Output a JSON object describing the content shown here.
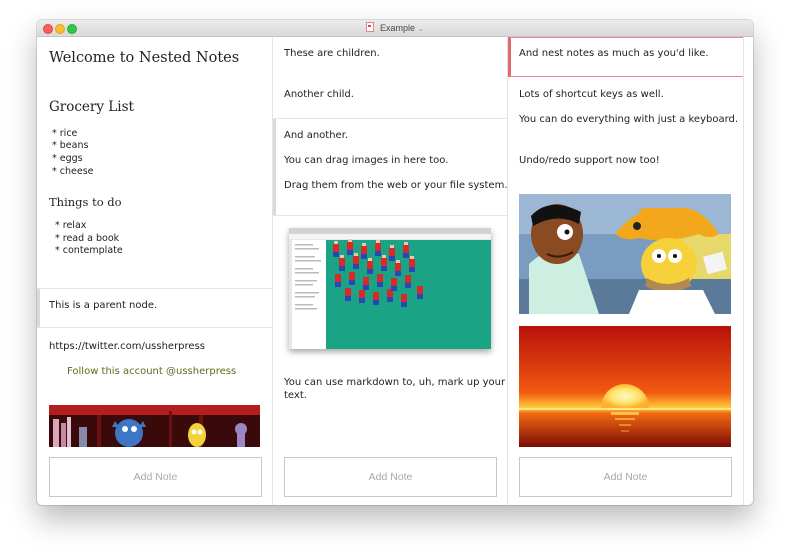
{
  "window": {
    "title": "Example"
  },
  "columns": [
    {
      "notes": {
        "welcome": "Welcome to Nested Notes",
        "grocery_title": "Grocery List",
        "grocery_items": [
          "* rice",
          "* beans",
          "* eggs",
          "* cheese"
        ],
        "todo_title": "Things to do",
        "todo_items": [
          "* relax",
          "* read a book",
          "* contemplate"
        ],
        "parent": "This is a parent node.",
        "url": "https://twitter.com/ussherpress",
        "follow": "Follow this account @ussherpress"
      },
      "add_note": "Add Note"
    },
    {
      "notes": {
        "children": "These are children.",
        "another_child": "Another child.",
        "and_another": "And another.",
        "drag_images": "You can drag images in here too.",
        "drag_from": "Drag them from the web or your file system.",
        "markdown": "You can use markdown to, uh, mark up your",
        "markdown_2": "text."
      },
      "add_note": "Add Note"
    },
    {
      "notes": {
        "nest": "And nest notes as much as you'd like.",
        "shortcuts": "Lots of shortcut keys as well.",
        "keyboard": "You can do everything with just a keyboard.",
        "undo": "Undo/redo support now too!"
      },
      "add_note": "Add Note"
    }
  ],
  "colors": {
    "selected_border": "#e8898f",
    "selected_bar": "#e06870",
    "link": "#5a6e1e"
  }
}
